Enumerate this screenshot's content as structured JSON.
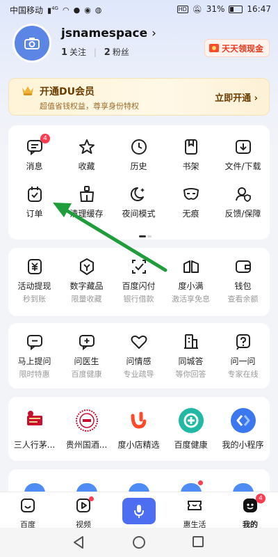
{
  "status_bar": {
    "carrier": "中国移动",
    "network": "4G",
    "hd": "HD",
    "battery": "31%",
    "time": "16:47"
  },
  "profile": {
    "username": "jsnamespace",
    "following_count": "1",
    "following_label": "关注",
    "fans_count": "2",
    "fans_label": "粉丝",
    "cash_button": "天天领现金"
  },
  "vip": {
    "title": "开通DU会员",
    "subtitle": "超值省钱权益，尊享身份特权",
    "action": "立即开通 ›"
  },
  "quick_tools": {
    "row1": [
      {
        "label": "消息",
        "icon": "message-icon",
        "badge": "4"
      },
      {
        "label": "收藏",
        "icon": "star-icon"
      },
      {
        "label": "历史",
        "icon": "clock-icon"
      },
      {
        "label": "书架",
        "icon": "bookshelf-icon"
      },
      {
        "label": "文件/下载",
        "icon": "download-icon"
      }
    ],
    "row2": [
      {
        "label": "订单",
        "icon": "order-icon"
      },
      {
        "label": "清理缓存",
        "icon": "clean-icon"
      },
      {
        "label": "夜间模式",
        "icon": "moon-icon"
      },
      {
        "label": "无痕",
        "icon": "mask-icon"
      },
      {
        "label": "反馈/保障",
        "icon": "feedback-icon"
      }
    ]
  },
  "finance": [
    {
      "label": "活动提现",
      "sub": "秒到账",
      "icon": "yuan-icon"
    },
    {
      "label": "数字藏品",
      "sub": "限量收藏",
      "icon": "collectible-icon"
    },
    {
      "label": "百度闪付",
      "sub": "银行借款",
      "icon": "pay-icon"
    },
    {
      "label": "度小满",
      "sub": "激活享免息",
      "icon": "duxiaoman-icon"
    },
    {
      "label": "钱包",
      "sub": "查看余额",
      "icon": "wallet-icon"
    }
  ],
  "services": [
    {
      "label": "马上提问",
      "sub": "限时特惠",
      "icon": "ask-icon"
    },
    {
      "label": "问医生",
      "sub": "百度健康",
      "icon": "doctor-icon"
    },
    {
      "label": "问情感",
      "sub": "专业疏导",
      "icon": "heart-icon"
    },
    {
      "label": "同城答",
      "sub": "等你回答",
      "icon": "city-icon"
    },
    {
      "label": "问一问",
      "sub": "专家在线",
      "icon": "question-icon"
    }
  ],
  "mini_programs": [
    {
      "label": "三人行茅...",
      "icon": "maotai-logo-icon",
      "color": "#c8102e"
    },
    {
      "label": "贵州国酒...",
      "icon": "guojiu-logo-icon",
      "color": "#c8102e"
    },
    {
      "label": "度小店精选",
      "icon": "dxd-logo-icon",
      "color": "#ff5a2a"
    },
    {
      "label": "百度健康",
      "icon": "health-logo-icon",
      "color": "#21b8a4"
    },
    {
      "label": "我的小程序",
      "icon": "miniapp-logo-icon",
      "color": "#3b78f0"
    }
  ],
  "tab_bar": [
    {
      "label": "百度",
      "icon": "home-icon"
    },
    {
      "label": "视频",
      "icon": "video-icon"
    },
    {
      "label": "",
      "icon": "microphone-icon"
    },
    {
      "label": "惠生活",
      "icon": "ticket-icon"
    },
    {
      "label": "我的",
      "icon": "me-icon",
      "badge": "4"
    }
  ],
  "colors": {
    "accent": "#4e6ef2",
    "badge": "#ff3b4f",
    "vip_text": "#6a3c00",
    "arrow": "#1f9d3a"
  }
}
